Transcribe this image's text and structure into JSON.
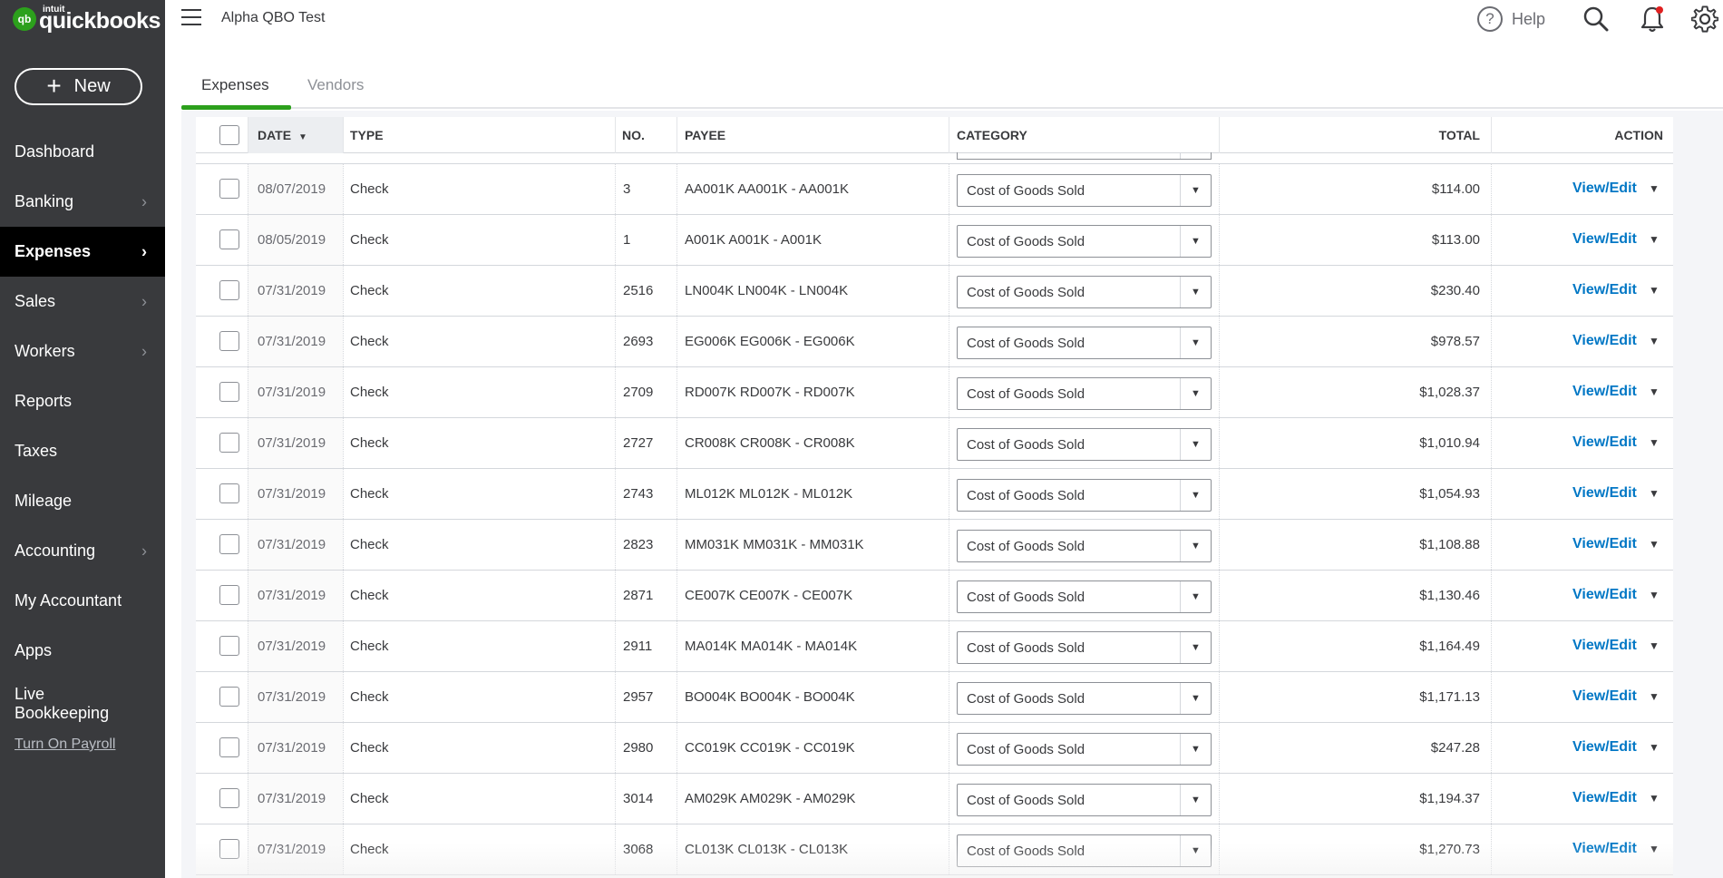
{
  "app": {
    "logo_intuit": "intuit",
    "logo_text": "quickbooks",
    "logo_mark": "qb",
    "company_name": "Alpha QBO Test"
  },
  "sidebar": {
    "new_label": "New",
    "items": [
      {
        "label": "Dashboard",
        "chevron": false,
        "active": false
      },
      {
        "label": "Banking",
        "chevron": true,
        "active": false
      },
      {
        "label": "Expenses",
        "chevron": true,
        "active": true
      },
      {
        "label": "Sales",
        "chevron": true,
        "active": false
      },
      {
        "label": "Workers",
        "chevron": true,
        "active": false
      },
      {
        "label": "Reports",
        "chevron": false,
        "active": false
      },
      {
        "label": "Taxes",
        "chevron": false,
        "active": false
      },
      {
        "label": "Mileage",
        "chevron": false,
        "active": false
      },
      {
        "label": "Accounting",
        "chevron": true,
        "active": false
      },
      {
        "label": "My Accountant",
        "chevron": false,
        "active": false
      },
      {
        "label": "Apps",
        "chevron": false,
        "active": false
      },
      {
        "label": "Live Bookkeeping",
        "chevron": false,
        "active": false
      }
    ],
    "payroll_link": "Turn On Payroll"
  },
  "topbar": {
    "help_label": "Help",
    "icons": [
      "hamburger-icon",
      "help-icon",
      "search-icon",
      "bell-icon",
      "gear-icon"
    ],
    "notification_dot_color": "#e02020"
  },
  "tabs": [
    {
      "label": "Expenses",
      "active": true
    },
    {
      "label": "Vendors",
      "active": false
    }
  ],
  "table": {
    "headers": {
      "date": "DATE",
      "type": "TYPE",
      "no": "NO.",
      "payee": "PAYEE",
      "category": "CATEGORY",
      "total": "TOTAL",
      "action": "ACTION"
    },
    "rows": [
      {
        "date": "08/07/2019",
        "type": "Check",
        "no": "3",
        "payee": "AA001K AA001K - AA001K",
        "category": "Cost of Goods Sold",
        "total": "$114.00",
        "action": "View/Edit"
      },
      {
        "date": "08/05/2019",
        "type": "Check",
        "no": "1",
        "payee": "A001K A001K - A001K",
        "category": "Cost of Goods Sold",
        "total": "$113.00",
        "action": "View/Edit"
      },
      {
        "date": "07/31/2019",
        "type": "Check",
        "no": "2516",
        "payee": "LN004K LN004K - LN004K",
        "category": "Cost of Goods Sold",
        "total": "$230.40",
        "action": "View/Edit"
      },
      {
        "date": "07/31/2019",
        "type": "Check",
        "no": "2693",
        "payee": "EG006K EG006K - EG006K",
        "category": "Cost of Goods Sold",
        "total": "$978.57",
        "action": "View/Edit"
      },
      {
        "date": "07/31/2019",
        "type": "Check",
        "no": "2709",
        "payee": "RD007K RD007K - RD007K",
        "category": "Cost of Goods Sold",
        "total": "$1,028.37",
        "action": "View/Edit"
      },
      {
        "date": "07/31/2019",
        "type": "Check",
        "no": "2727",
        "payee": "CR008K CR008K - CR008K",
        "category": "Cost of Goods Sold",
        "total": "$1,010.94",
        "action": "View/Edit"
      },
      {
        "date": "07/31/2019",
        "type": "Check",
        "no": "2743",
        "payee": "ML012K ML012K - ML012K",
        "category": "Cost of Goods Sold",
        "total": "$1,054.93",
        "action": "View/Edit"
      },
      {
        "date": "07/31/2019",
        "type": "Check",
        "no": "2823",
        "payee": "MM031K MM031K - MM031K",
        "category": "Cost of Goods Sold",
        "total": "$1,108.88",
        "action": "View/Edit"
      },
      {
        "date": "07/31/2019",
        "type": "Check",
        "no": "2871",
        "payee": "CE007K CE007K - CE007K",
        "category": "Cost of Goods Sold",
        "total": "$1,130.46",
        "action": "View/Edit"
      },
      {
        "date": "07/31/2019",
        "type": "Check",
        "no": "2911",
        "payee": "MA014K MA014K - MA014K",
        "category": "Cost of Goods Sold",
        "total": "$1,164.49",
        "action": "View/Edit"
      },
      {
        "date": "07/31/2019",
        "type": "Check",
        "no": "2957",
        "payee": "BO004K BO004K - BO004K",
        "category": "Cost of Goods Sold",
        "total": "$1,171.13",
        "action": "View/Edit"
      },
      {
        "date": "07/31/2019",
        "type": "Check",
        "no": "2980",
        "payee": "CC019K CC019K - CC019K",
        "category": "Cost of Goods Sold",
        "total": "$247.28",
        "action": "View/Edit"
      },
      {
        "date": "07/31/2019",
        "type": "Check",
        "no": "3014",
        "payee": "AM029K AM029K - AM029K",
        "category": "Cost of Goods Sold",
        "total": "$1,194.37",
        "action": "View/Edit"
      },
      {
        "date": "07/31/2019",
        "type": "Check",
        "no": "3068",
        "payee": "CL013K CL013K - CL013K",
        "category": "Cost of Goods Sold",
        "total": "$1,270.73",
        "action": "View/Edit"
      }
    ]
  },
  "colors": {
    "sidebar_bg": "#393a3d",
    "sidebar_active_bg": "#000000",
    "brand_green": "#2ca01c",
    "link_blue": "#0077c5"
  }
}
